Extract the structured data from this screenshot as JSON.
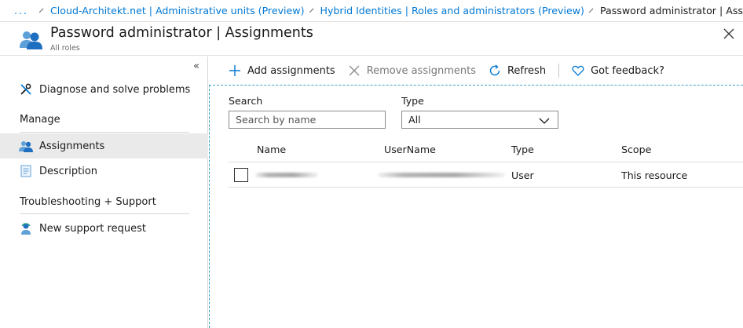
{
  "breadcrumb": {
    "ellipsis": "...",
    "items": [
      "Cloud-Architekt.net | Administrative units (Preview)",
      "Hybrid Identities | Roles and administrators (Preview)"
    ],
    "current": "Password administrator | Assignments"
  },
  "header": {
    "title": "Password administrator | Assignments",
    "subtitle": "All roles",
    "icon": "users-group-icon"
  },
  "sidebar": {
    "collapse_glyph": "«",
    "top_item": {
      "label": "Diagnose and solve problems",
      "icon": "wrench-icon"
    },
    "manage_header": "Manage",
    "manage_items": [
      {
        "label": "Assignments",
        "icon": "users-icon",
        "active": true
      },
      {
        "label": "Description",
        "icon": "document-icon",
        "active": false
      }
    ],
    "support_header": "Troubleshooting + Support",
    "support_items": [
      {
        "label": "New support request",
        "icon": "support-person-icon"
      }
    ]
  },
  "toolbar": {
    "add_label": "Add assignments",
    "remove_label": "Remove assignments",
    "refresh_label": "Refresh",
    "feedback_label": "Got feedback?"
  },
  "filters": {
    "search_label": "Search",
    "search_placeholder": "Search by name",
    "type_label": "Type",
    "type_value": "All"
  },
  "table": {
    "columns": [
      "Name",
      "UserName",
      "Type",
      "Scope"
    ],
    "rows": [
      {
        "name": "",
        "username": "",
        "type": "User",
        "scope": "This resource"
      }
    ]
  },
  "colors": {
    "accent": "#0078d4",
    "selection_bg": "#eaeaea",
    "dashed_border": "#3aa0c8"
  }
}
